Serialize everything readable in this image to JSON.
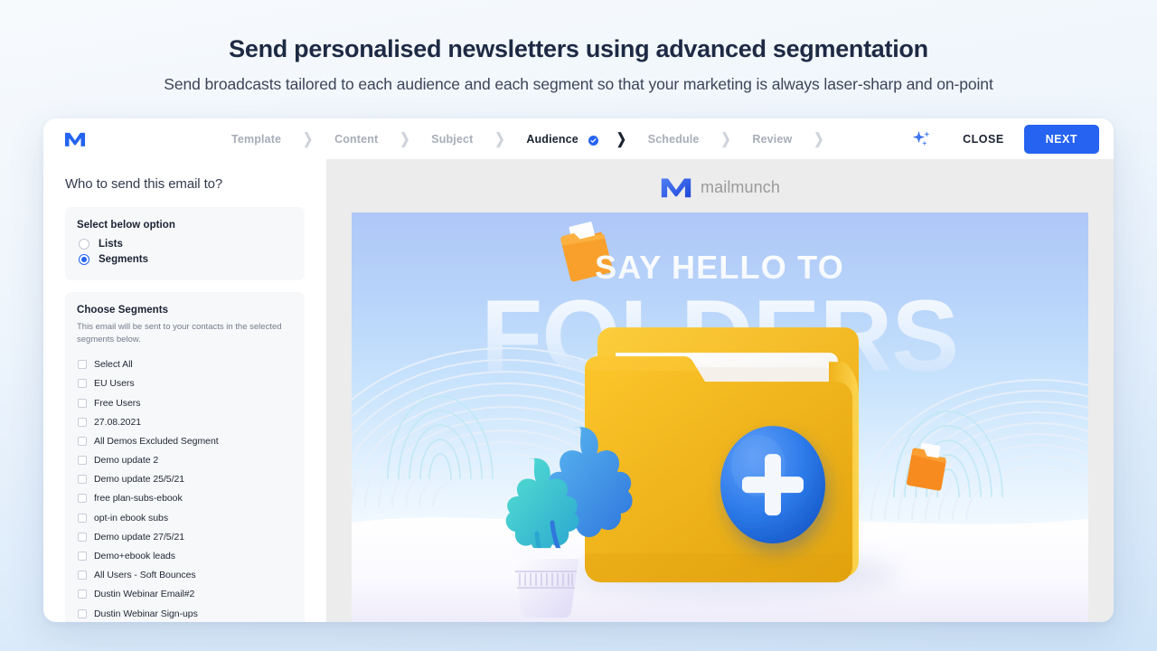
{
  "headline": {
    "title": "Send personalised newsletters using advanced segmentation",
    "subtitle": "Send broadcasts tailored to each audience and each segment so that your marketing is always laser-sharp and on-point"
  },
  "topbar": {
    "logo_name": "mailmunch-logo",
    "steps": [
      {
        "label": "Template",
        "active": false
      },
      {
        "label": "Content",
        "active": false
      },
      {
        "label": "Subject",
        "active": false
      },
      {
        "label": "Audience",
        "active": true
      },
      {
        "label": "Schedule",
        "active": false
      },
      {
        "label": "Review",
        "active": false
      }
    ],
    "ai_icon": "sparkle-icon",
    "close_label": "CLOSE",
    "next_label": "NEXT",
    "accent_color": "#2563f0"
  },
  "sidebar": {
    "title": "Who to send this email to?",
    "option_panel": {
      "title": "Select below option",
      "options": [
        {
          "label": "Lists",
          "selected": false
        },
        {
          "label": "Segments",
          "selected": true
        }
      ]
    },
    "segments_panel": {
      "title": "Choose Segments",
      "description": "This email will be sent to your contacts in the selected segments below.",
      "items": [
        {
          "label": "Select All",
          "checked": false
        },
        {
          "label": "EU Users",
          "checked": false
        },
        {
          "label": "Free Users",
          "checked": false
        },
        {
          "label": "27.08.2021",
          "checked": false
        },
        {
          "label": "All Demos Excluded Segment",
          "checked": false
        },
        {
          "label": "Demo update 2",
          "checked": false
        },
        {
          "label": "Demo update 25/5/21",
          "checked": false
        },
        {
          "label": "free plan-subs-ebook",
          "checked": false
        },
        {
          "label": "opt-in ebook subs",
          "checked": false
        },
        {
          "label": "Demo update 27/5/21",
          "checked": false
        },
        {
          "label": "Demo+ebook leads",
          "checked": false
        },
        {
          "label": "All Users - Soft Bounces",
          "checked": false
        },
        {
          "label": "Dustin Webinar Email#2",
          "checked": false
        },
        {
          "label": "Dustin Webinar Sign-ups",
          "checked": false
        }
      ]
    }
  },
  "preview": {
    "brand_mark": "mailmunch-logo-mark",
    "brand_word": "mailmunch",
    "hero": {
      "eyebrow": "SAY HELLO TO",
      "title": "FOLDERS",
      "folder_color": "#f0b520",
      "badge_color": "#2e7ceb",
      "accent_orange": "#f7941e",
      "sky_color": "#b6cff9"
    }
  }
}
